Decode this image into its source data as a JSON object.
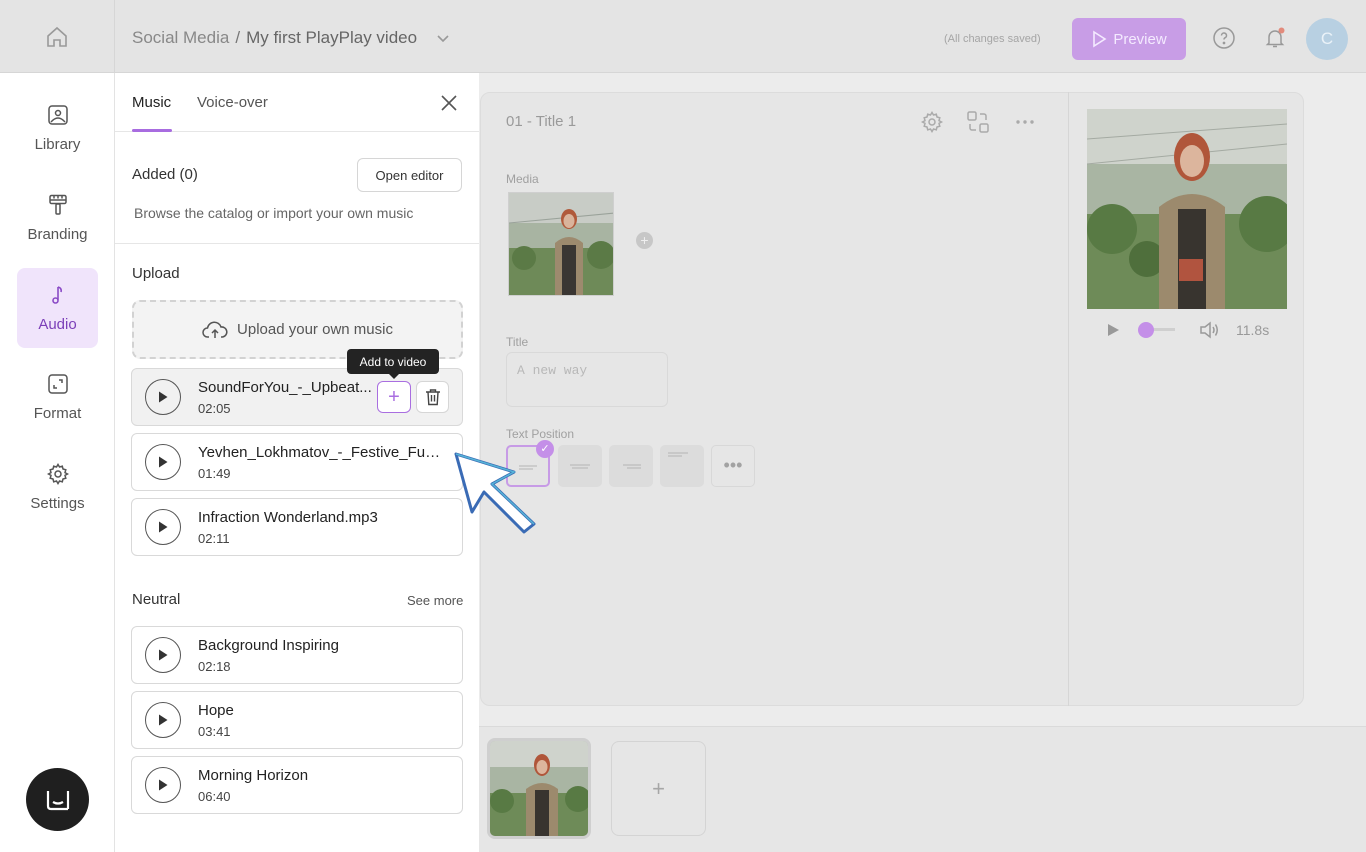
{
  "header": {
    "breadcrumb_section": "Social Media",
    "breadcrumb_separator": "/",
    "project_name": "My first PlayPlay video",
    "save_status": "(All changes saved)",
    "preview_label": "Preview",
    "avatar_initial": "C"
  },
  "nav": {
    "items": [
      {
        "label": "Library",
        "icon": "image-icon"
      },
      {
        "label": "Branding",
        "icon": "paint-roller-icon"
      },
      {
        "label": "Audio",
        "icon": "music-note-icon",
        "active": true
      },
      {
        "label": "Format",
        "icon": "resize-icon"
      },
      {
        "label": "Settings",
        "icon": "gear-icon"
      }
    ]
  },
  "panel": {
    "tabs": [
      {
        "label": "Music",
        "active": true
      },
      {
        "label": "Voice-over",
        "active": false
      }
    ],
    "added_label": "Added (0)",
    "open_editor_label": "Open editor",
    "browse_hint": "Browse the catalog or import your own music",
    "upload_section": "Upload",
    "upload_button": "Upload your own music",
    "tooltip": "Add to video",
    "uploaded_tracks": [
      {
        "name": "SoundForYou_-_Upbeat...",
        "duration": "02:05"
      },
      {
        "name": "Yevhen_Lokhmatov_-_Festive_Fun....",
        "duration": "01:49"
      },
      {
        "name": "Infraction Wonderland.mp3",
        "duration": "02:11"
      }
    ],
    "neutral_section": "Neutral",
    "see_more": "See more",
    "neutral_tracks": [
      {
        "name": "Background Inspiring",
        "duration": "02:18"
      },
      {
        "name": "Hope",
        "duration": "03:41"
      },
      {
        "name": "Morning Horizon",
        "duration": "06:40"
      }
    ]
  },
  "editor": {
    "scene_title": "01 - Title 1",
    "media_label": "Media",
    "title_label": "Title",
    "title_value": "A new way",
    "text_position_label": "Text Position",
    "more_label": "•••",
    "player_time": "11.8s",
    "add_scene_symbol": "+"
  },
  "colors": {
    "accent": "#a86ce0",
    "active_nav_bg": "#f0e4fb",
    "preview_button": "#c89de6"
  }
}
